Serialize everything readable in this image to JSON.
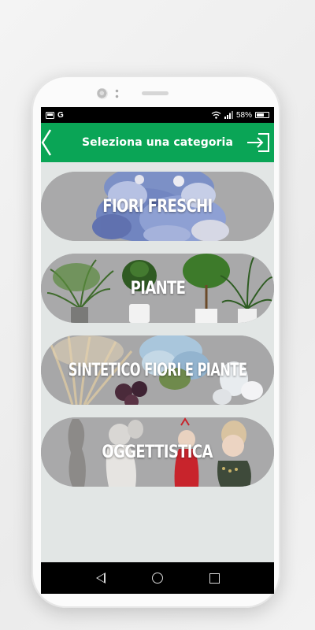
{
  "status_bar": {
    "left_icons": [
      "image-icon",
      "g-icon"
    ],
    "left_text": "G",
    "battery_percent": "58%"
  },
  "app_bar": {
    "title": "Seleziona una categoria",
    "back_icon": "chevron-left-icon",
    "exit_icon": "logout-icon",
    "color": "#0aa556"
  },
  "categories": [
    {
      "label": "FIORI FRESCHI"
    },
    {
      "label": "PIANTE"
    },
    {
      "label": "SINTETICO FIORI E PIANTE"
    },
    {
      "label": "OGGETTISTICA"
    }
  ],
  "nav_bar": {
    "icons": [
      "nav-back-icon",
      "nav-home-icon",
      "nav-recents-icon"
    ]
  }
}
